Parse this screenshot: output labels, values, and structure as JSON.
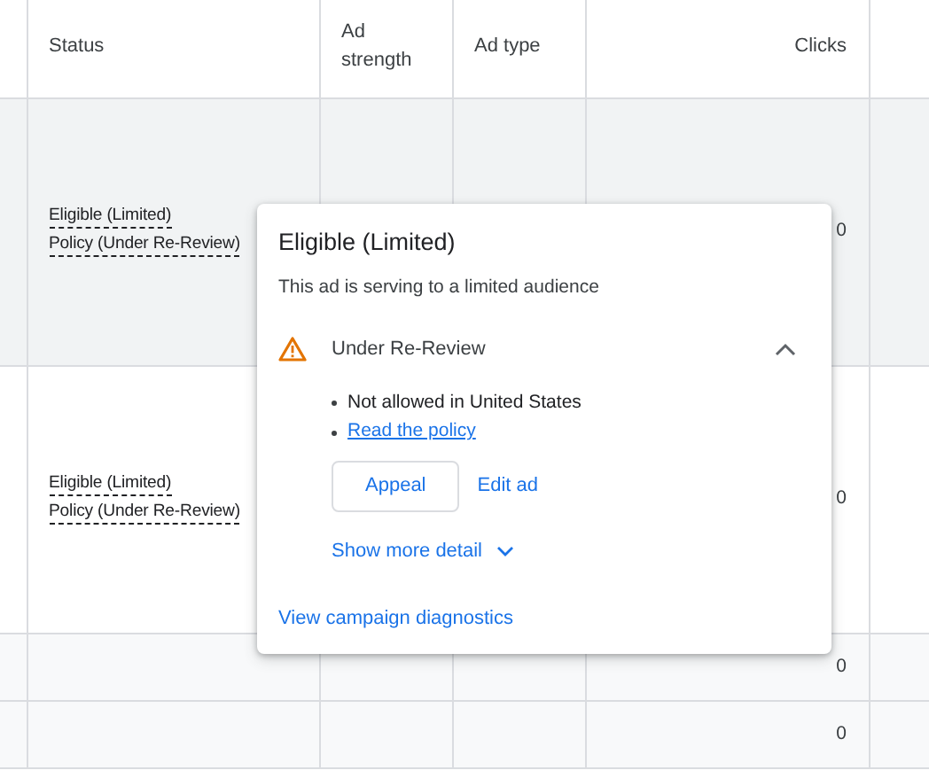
{
  "table": {
    "columns": [
      {
        "label": "Status",
        "kind": "text"
      },
      {
        "label": "Ad strength",
        "kind": "text"
      },
      {
        "label": "Ad type",
        "kind": "text"
      },
      {
        "label": "Clicks",
        "kind": "number"
      }
    ],
    "rows": [
      {
        "kind": "ad",
        "highlighted": true,
        "status": [
          "Eligible (Limited)",
          "Policy (Under Re-Review)"
        ],
        "clicks": "0"
      },
      {
        "kind": "ad",
        "highlighted": false,
        "status": [
          "Eligible (Limited)",
          "Policy (Under Re-Review)"
        ],
        "clicks": "0"
      },
      {
        "kind": "summary",
        "status": [],
        "clicks": "0"
      },
      {
        "kind": "summary",
        "status": [],
        "clicks": "0"
      }
    ]
  },
  "popup": {
    "title": "Eligible (Limited)",
    "subtitle": "This ad is serving to a limited audience",
    "issue": {
      "title": "Under Re-Review",
      "expanded": true,
      "bullets": [
        {
          "kind": "text",
          "text": "Not allowed in United States"
        },
        {
          "kind": "link",
          "text": "Read the policy"
        }
      ],
      "buttons": [
        {
          "kind": "outlined",
          "label": "Appeal"
        },
        {
          "kind": "text",
          "label": "Edit ad"
        }
      ],
      "more": {
        "label": "Show more detail",
        "expanded": false
      }
    },
    "footer_link": "View campaign diagnostics"
  }
}
